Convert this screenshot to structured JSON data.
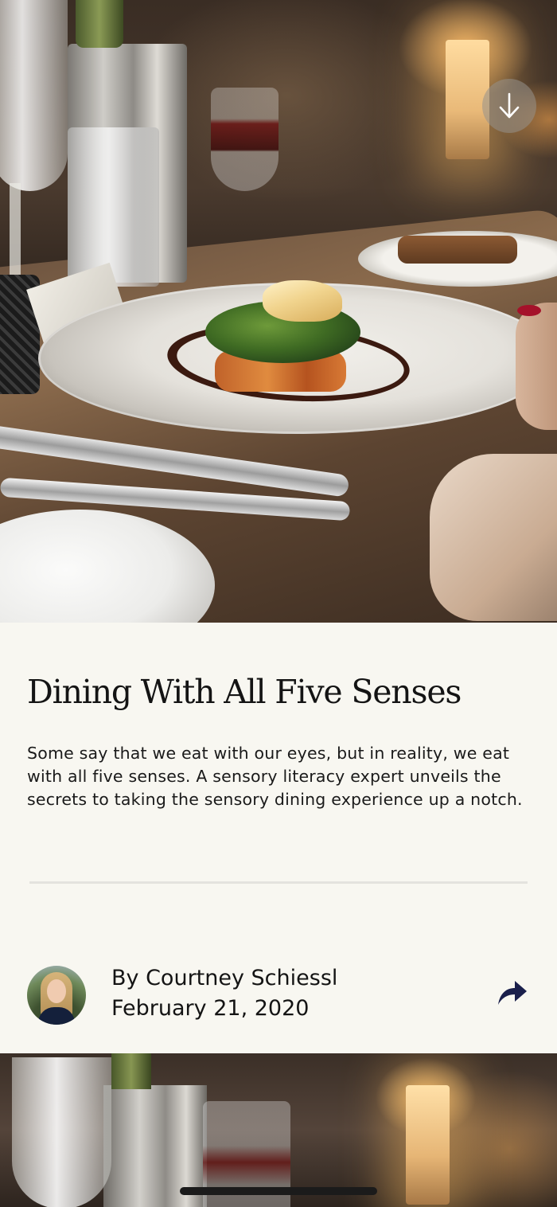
{
  "hero": {
    "image_alt": "Plated fish dish on a restaurant dinner table",
    "scroll_icon": "arrow-down-icon"
  },
  "article": {
    "title": "Dining With All Five Senses",
    "summary": "Some say that we eat with our eyes, but in reality, we eat with all five senses. A sensory literacy expert unveils the secrets to taking the sensory dining experience up a notch.",
    "author_line": "By Courtney Schiessl",
    "date": "February 21, 2020",
    "share_icon": "share-arrow-icon"
  },
  "next_article": {
    "image_alt": "Restaurant table with glasses and candles"
  },
  "colors": {
    "background": "#f8f7f1",
    "text": "#141414",
    "divider": "#e4e3de",
    "share_icon": "#1a1f4b"
  }
}
